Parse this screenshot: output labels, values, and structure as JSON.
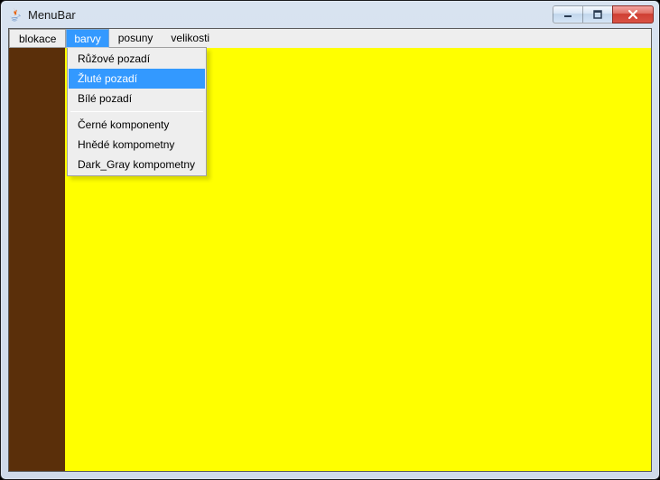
{
  "window": {
    "title": "MenuBar"
  },
  "menubar": {
    "items": [
      "blokace",
      "barvy",
      "posuny",
      "velikosti"
    ],
    "selected_index": 1
  },
  "dropdown": {
    "group1": [
      "Růžové pozadí",
      "Žluté pozadí",
      "Bílé pozadí"
    ],
    "highlight_index": 1,
    "group2": [
      "Černé komponenty",
      "Hnědé kompometny",
      "Dark_Gray kompometny"
    ]
  },
  "colors": {
    "side_panel": "#5a2f0a",
    "main_panel": "#ffff00"
  }
}
